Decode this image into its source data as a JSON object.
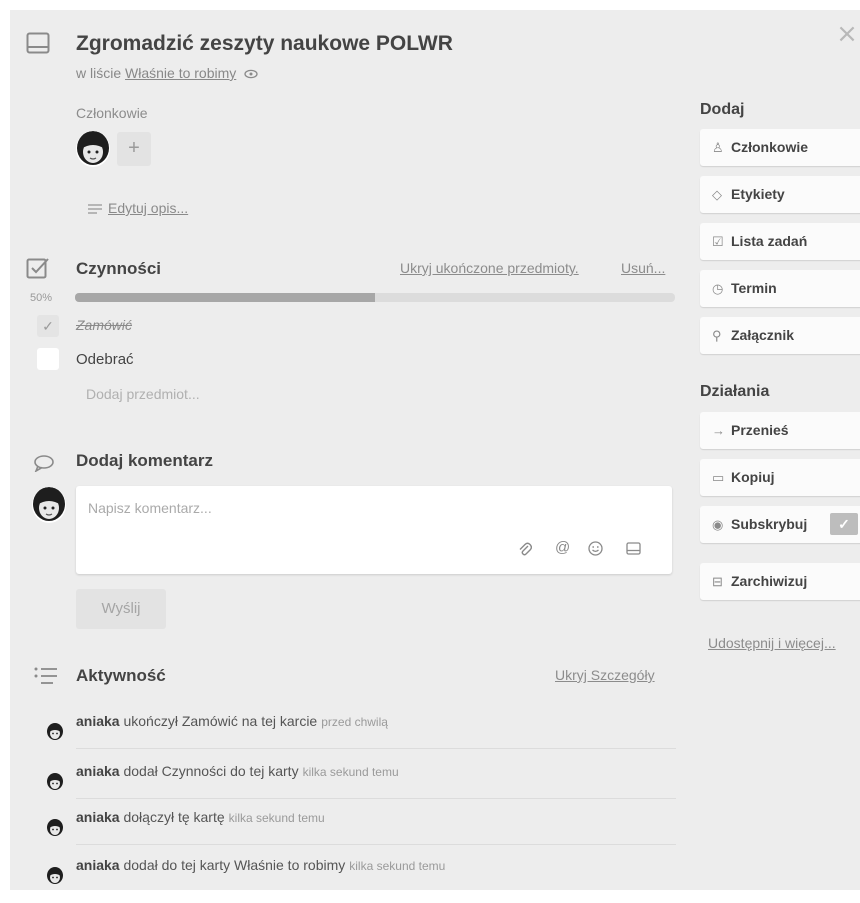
{
  "card": {
    "title": "Zgromadzić zeszyty naukowe POLWR",
    "list_prefix": "w liście",
    "list_name": "Właśnie to robimy"
  },
  "members": {
    "label": "Członkowie",
    "add_symbol": "+"
  },
  "description": {
    "edit_label": "Edytuj opis..."
  },
  "checklist": {
    "title": "Czynności",
    "hide_completed": "Ukryj ukończone przedmioty.",
    "delete": "Usuń...",
    "progress_text": "50%",
    "progress": 0.5,
    "items": [
      {
        "text": "Zamówić",
        "done": true
      },
      {
        "text": "Odebrać",
        "done": false
      }
    ],
    "add_item": "Dodaj przedmiot..."
  },
  "comment": {
    "title": "Dodaj komentarz",
    "placeholder": "Napisz komentarz...",
    "send": "Wyślij",
    "tool_icons": [
      "attachment-icon",
      "mention-icon",
      "emoji-icon",
      "card-icon"
    ]
  },
  "activity": {
    "title": "Aktywność",
    "toggle": "Ukryj Szczegóły",
    "entries": [
      {
        "user": "aniaka",
        "action": "ukończył Zamówić na tej karcie",
        "time": "przed chwilą"
      },
      {
        "user": "aniaka",
        "action": "dodał Czynności do tej karty",
        "time": "kilka sekund temu"
      },
      {
        "user": "aniaka",
        "action": "dołączył tę kartę",
        "time": "kilka sekund temu"
      },
      {
        "user": "aniaka",
        "action": "dodał do tej karty Właśnie to robimy",
        "time": "kilka sekund temu"
      }
    ]
  },
  "sidebar": {
    "add_heading": "Dodaj",
    "add_buttons": [
      {
        "label": "Członkowie",
        "icon": "person-icon"
      },
      {
        "label": "Etykiety",
        "icon": "label-icon"
      },
      {
        "label": "Lista zadań",
        "icon": "checklist-icon"
      },
      {
        "label": "Termin",
        "icon": "clock-icon"
      },
      {
        "label": "Załącznik",
        "icon": "paperclip-icon"
      }
    ],
    "actions_heading": "Działania",
    "action_buttons": [
      {
        "label": "Przenieś",
        "icon": "arrow-right-icon"
      },
      {
        "label": "Kopiuj",
        "icon": "card-icon"
      },
      {
        "label": "Subskrybuj",
        "icon": "eye-icon",
        "checked": true
      },
      {
        "label": "Zarchiwizuj",
        "icon": "archive-icon"
      }
    ],
    "share_link": "Udostępnij i więcej..."
  },
  "colors": {
    "background": "#ededed",
    "button": "#fbfbfb",
    "progress_fill": "#a7a7a7",
    "progress_track": "#dcdcdc"
  }
}
